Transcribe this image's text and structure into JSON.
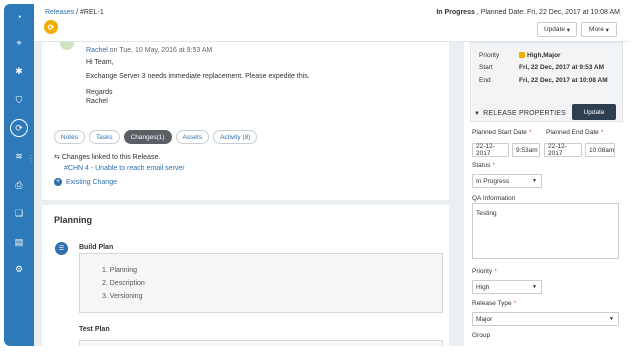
{
  "breadcrumb": {
    "parent": "Releases",
    "separator": " / ",
    "current": "#REL-1"
  },
  "header": {
    "status": "In Progress",
    "planned_date": " , Planned Date: Fri, 22 Dec, 2017 at 10:08 AM",
    "update_button": "Update",
    "more_button": "More"
  },
  "comment": {
    "author": "Rachel",
    "timestamp": " on Tue, 10 May, 2016 at 9:53 AM",
    "greeting": "Hi Team,",
    "body": "Exchange Server 3 needs immediate replacement. Please expedite this.",
    "signoff": "Regards",
    "signature": "Rachel"
  },
  "tabs": [
    {
      "label": "Notes",
      "active": false
    },
    {
      "label": "Tasks",
      "active": false
    },
    {
      "label": "Changes(1)",
      "active": true
    },
    {
      "label": "Assets",
      "active": false
    },
    {
      "label": "Activity (8)",
      "active": false
    }
  ],
  "changes": {
    "heading": "Changes linked to this Release.",
    "link": "#CHN 4 - Unable to reach email server",
    "existing_button": "Existing Change"
  },
  "planning": {
    "title": "Planning",
    "build_plan_title": "Build Plan",
    "build_plan_items": [
      "1. Planning",
      "2. Description",
      "3. Versioning"
    ],
    "test_plan_title": "Test Plan"
  },
  "info": {
    "priority_label": "Priority",
    "priority_value": "High,Major",
    "start_label": "Start",
    "start_value": "Fri, 22 Dec, 2017 at 9:53 AM",
    "end_label": "End",
    "end_value": "Fri, 22 Dec, 2017 at 10:08 AM"
  },
  "release_properties": {
    "heading": "RELEASE PROPERTIES",
    "update_button": "Update",
    "planned_start_label": "Planned Start Date",
    "planned_end_label": "Planned End Date",
    "start_date": "22-12-2017",
    "start_time": "9:53am",
    "end_date": "22-12-2017",
    "end_time": "10:08am",
    "status_label": "Status",
    "status_value": "In Progress",
    "qa_label": "QA Information",
    "qa_value": "Testing",
    "priority_label": "Priority",
    "priority_value": "High",
    "release_type_label": "Release Type",
    "release_type_value": "Major",
    "group_label": "Group"
  },
  "colors": {
    "accent": "#2f6fb0",
    "sidebar": "#2e7ab8",
    "badge": "#f0ad00",
    "dark_button": "#2d3e50"
  }
}
